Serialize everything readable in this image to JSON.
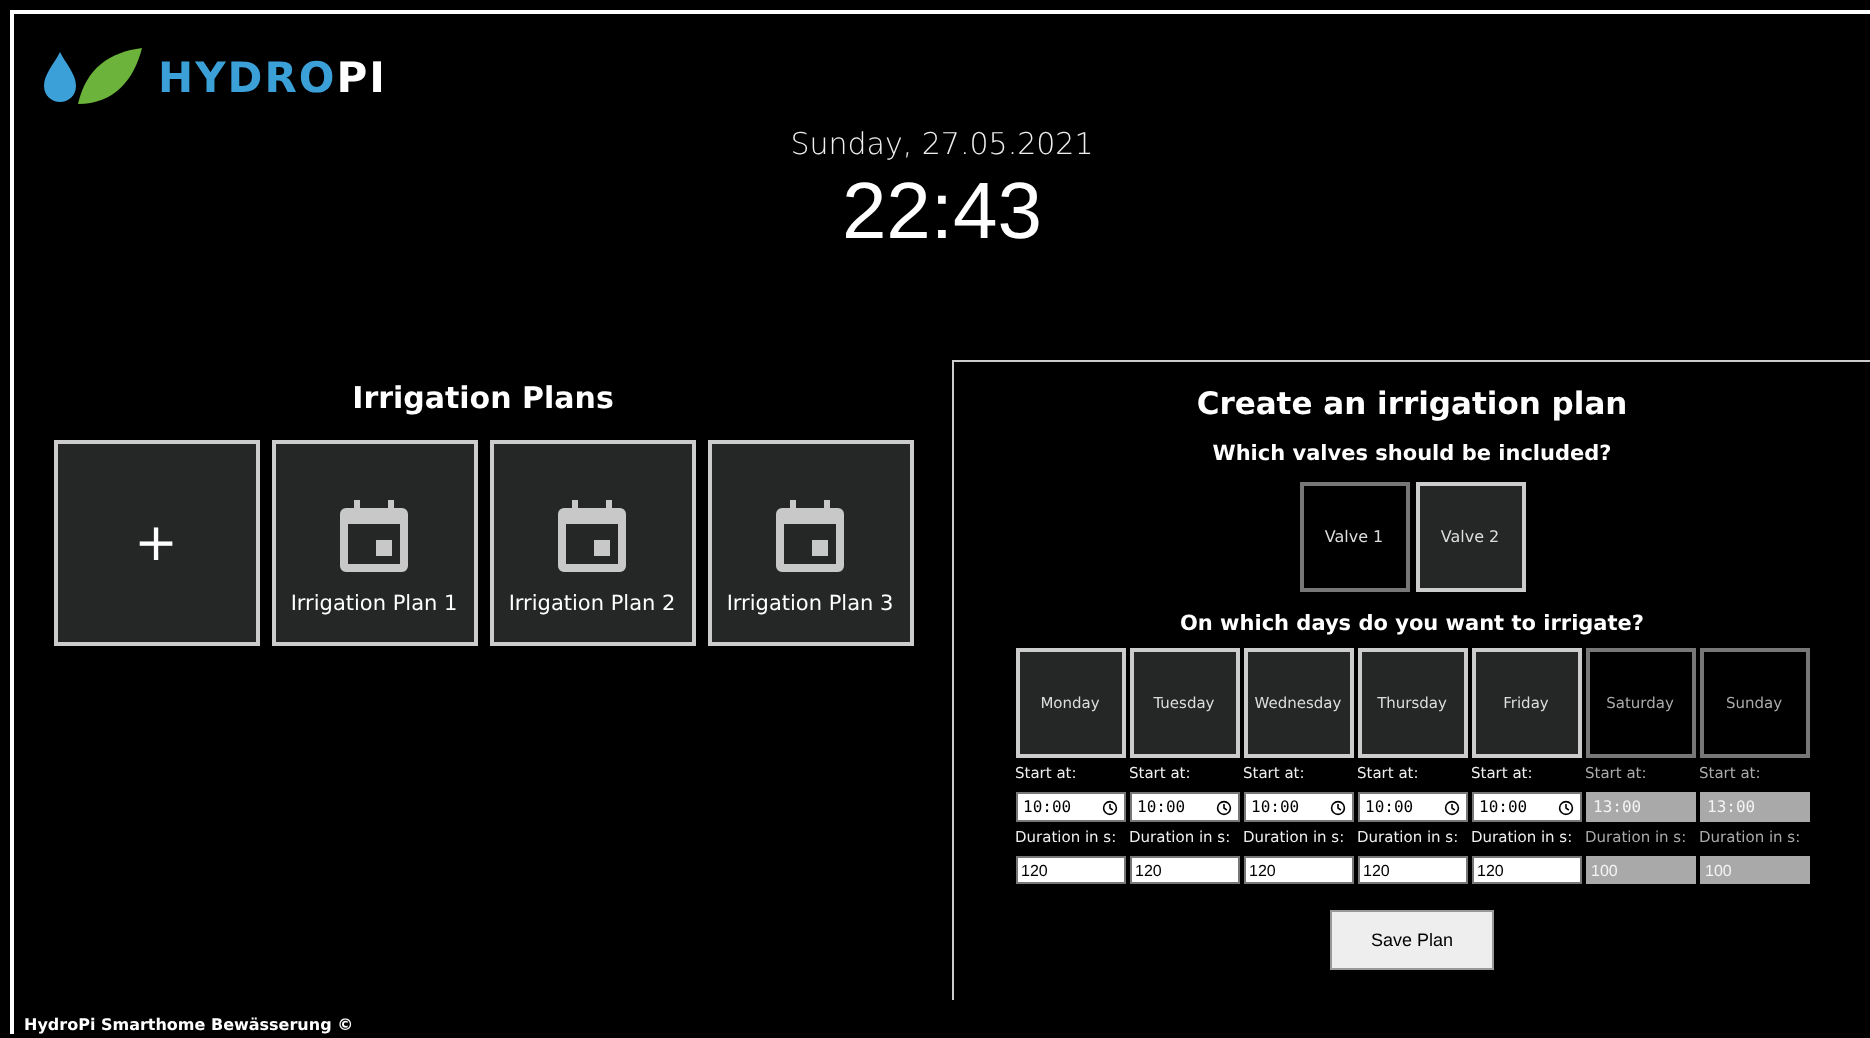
{
  "logo": {
    "brand": "HYDRO",
    "suffix": "PI"
  },
  "date": "Sunday, 27.05.2021",
  "time": "22:43",
  "plans": {
    "title": "Irrigation Plans",
    "add_label": "+",
    "items": [
      {
        "label": "Irrigation Plan 1"
      },
      {
        "label": "Irrigation Plan 2"
      },
      {
        "label": "Irrigation Plan 3"
      }
    ]
  },
  "create": {
    "title": "Create an irrigation plan",
    "valves_question": "Which valves should be included?",
    "valves": [
      {
        "label": "Valve 1",
        "selected": false
      },
      {
        "label": "Valve 2",
        "selected": true
      }
    ],
    "days_question": "On which days do you want to irrigate?",
    "days": [
      {
        "name": "Monday",
        "selected": true,
        "start_label": "Start at:",
        "start": "10:00",
        "duration_label": "Duration in s:",
        "duration": "120"
      },
      {
        "name": "Tuesday",
        "selected": true,
        "start_label": "Start at:",
        "start": "10:00",
        "duration_label": "Duration in s:",
        "duration": "120"
      },
      {
        "name": "Wednesday",
        "selected": true,
        "start_label": "Start at:",
        "start": "10:00",
        "duration_label": "Duration in s:",
        "duration": "120"
      },
      {
        "name": "Thursday",
        "selected": true,
        "start_label": "Start at:",
        "start": "10:00",
        "duration_label": "Duration in s:",
        "duration": "120"
      },
      {
        "name": "Friday",
        "selected": true,
        "start_label": "Start at:",
        "start": "10:00",
        "duration_label": "Duration in s:",
        "duration": "120"
      },
      {
        "name": "Saturday",
        "selected": false,
        "start_label": "Start at:",
        "start": "13:00",
        "duration_label": "Duration in s:",
        "duration": "100"
      },
      {
        "name": "Sunday",
        "selected": false,
        "start_label": "Start at:",
        "start": "13:00",
        "duration_label": "Duration in s:",
        "duration": "100"
      }
    ],
    "save_button": "Save Plan"
  },
  "footer": "HydroPi Smarthome Bewässerung ©"
}
